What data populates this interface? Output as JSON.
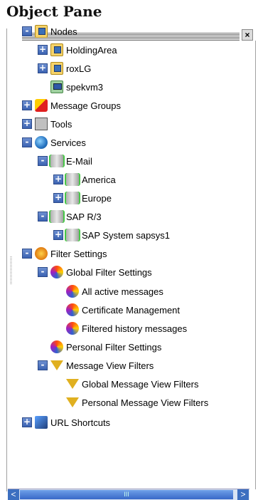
{
  "title": "Object Pane",
  "tree": [
    {
      "label": "Nodes",
      "indent": 0,
      "exp": "-",
      "icon": "nodes-icon"
    },
    {
      "label": "HoldingArea",
      "indent": 1,
      "exp": "+",
      "icon": "nodes-icon"
    },
    {
      "label": "roxLG",
      "indent": 1,
      "exp": "+",
      "icon": "nodes-icon"
    },
    {
      "label": "spekvm3",
      "indent": 1,
      "exp": "",
      "icon": "monitor-icon"
    },
    {
      "label": "Message Groups",
      "indent": 0,
      "exp": "+",
      "icon": "message-groups-icon"
    },
    {
      "label": "Tools",
      "indent": 0,
      "exp": "+",
      "icon": "tools-icon"
    },
    {
      "label": "Services",
      "indent": 0,
      "exp": "-",
      "icon": "globe-icon"
    },
    {
      "label": "E-Mail",
      "indent": 1,
      "exp": "-",
      "icon": "service-icon"
    },
    {
      "label": "America",
      "indent": 2,
      "exp": "+",
      "icon": "service-icon"
    },
    {
      "label": "Europe",
      "indent": 2,
      "exp": "+",
      "icon": "service-icon"
    },
    {
      "label": "SAP R/3",
      "indent": 1,
      "exp": "-",
      "icon": "service-icon"
    },
    {
      "label": "SAP System sapsys1",
      "indent": 2,
      "exp": "+",
      "icon": "service-icon"
    },
    {
      "label": "Filter Settings",
      "indent": 0,
      "exp": "-",
      "icon": "filter-icon"
    },
    {
      "label": "Global Filter Settings",
      "indent": 1,
      "exp": "-",
      "icon": "filter-swirl-icon"
    },
    {
      "label": "All active messages",
      "indent": 2,
      "exp": "",
      "icon": "filter-swirl-icon"
    },
    {
      "label": "Certificate Management",
      "indent": 2,
      "exp": "",
      "icon": "filter-swirl-icon"
    },
    {
      "label": "Filtered history messages",
      "indent": 2,
      "exp": "",
      "icon": "filter-swirl-icon"
    },
    {
      "label": "Personal Filter Settings",
      "indent": 1,
      "exp": "",
      "icon": "filter-swirl-icon"
    },
    {
      "label": "Message View Filters",
      "indent": 1,
      "exp": "-",
      "icon": "funnel-icon"
    },
    {
      "label": "Global Message View Filters",
      "indent": 2,
      "exp": "",
      "icon": "funnel-icon"
    },
    {
      "label": "Personal Message View Filters",
      "indent": 2,
      "exp": "",
      "icon": "funnel-icon"
    },
    {
      "label": "URL Shortcuts",
      "indent": 0,
      "exp": "+",
      "icon": "url-shortcuts-icon"
    }
  ],
  "scrollbar": {
    "left": "<",
    "right": ">",
    "thumb": "III"
  },
  "close": "×"
}
